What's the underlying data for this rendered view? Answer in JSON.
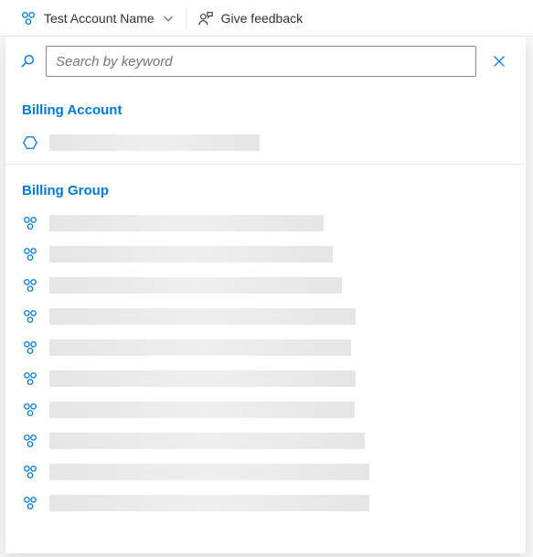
{
  "header": {
    "account_label": "Test Account Name",
    "feedback_label": "Give feedback"
  },
  "dropdown": {
    "search": {
      "placeholder": "Search by keyword",
      "value": ""
    },
    "sections": {
      "billing_account": {
        "title": "Billing Account",
        "items": [
          {
            "label": "",
            "redacted_width": 230
          }
        ]
      },
      "billing_group": {
        "title": "Billing Group",
        "items": [
          {
            "label": "",
            "redacted_width": 300
          },
          {
            "label": "",
            "redacted_width": 310
          },
          {
            "label": "",
            "redacted_width": 320
          },
          {
            "label": "",
            "redacted_width": 335
          },
          {
            "label": "",
            "redacted_width": 330
          },
          {
            "label": "",
            "redacted_width": 335
          },
          {
            "label": "",
            "redacted_width": 334
          },
          {
            "label": "",
            "redacted_width": 345
          },
          {
            "label": "",
            "redacted_width": 350
          },
          {
            "label": "",
            "redacted_width": 350
          }
        ]
      }
    }
  },
  "colors": {
    "accent": "#0078d4"
  },
  "icons": {
    "group": "group-icon",
    "person_feedback": "person-feedback-icon",
    "chevron_down": "chevron-down-icon",
    "search": "search-icon",
    "close": "close-icon",
    "hexagon": "hexagon-icon"
  }
}
